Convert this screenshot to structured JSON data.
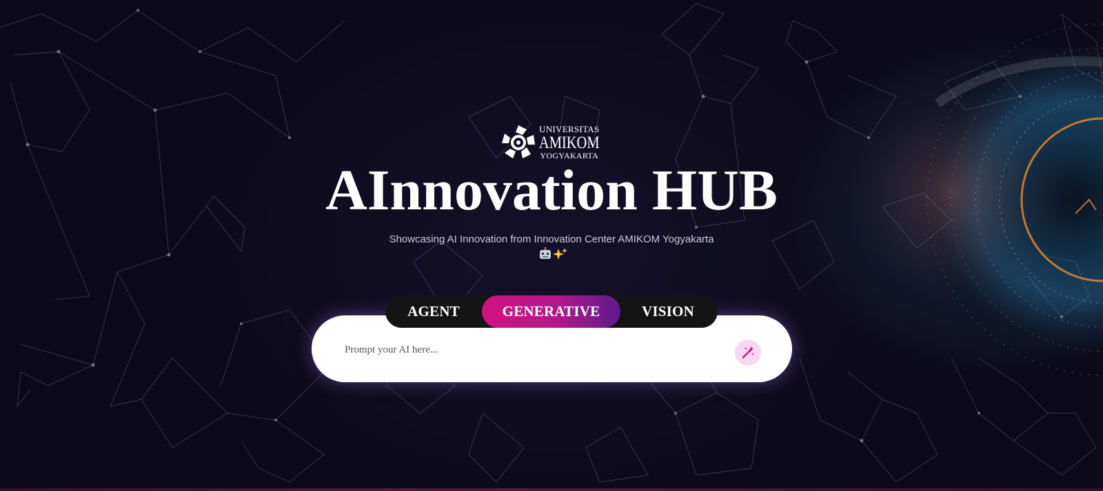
{
  "brand": {
    "logo_line1": "UNIVERSITAS",
    "logo_line2": "AMIKOM",
    "logo_line3": "YOGYAKARTA",
    "logo_icon": "amikom-swirl-icon"
  },
  "hero": {
    "title": "AInnovation HUB",
    "subtitle": "Showcasing AI Innovation from Innovation Center AMIKOM Yogyakarta",
    "emoji": "🤖✨"
  },
  "tabs": [
    {
      "label": "AGENT",
      "active": false
    },
    {
      "label": "GENERATIVE",
      "active": true
    },
    {
      "label": "VISION",
      "active": false
    }
  ],
  "prompt": {
    "placeholder": "Prompt your AI here...",
    "value": "",
    "submit_icon": "magic-wand-icon"
  },
  "colors": {
    "background": "#0e0b1c",
    "accent_pink": "#d0127f",
    "accent_purple": "#5a1a8f",
    "tab_bar": "#141414",
    "button_bg": "#f8d8f0",
    "icon": "#d0127f"
  }
}
